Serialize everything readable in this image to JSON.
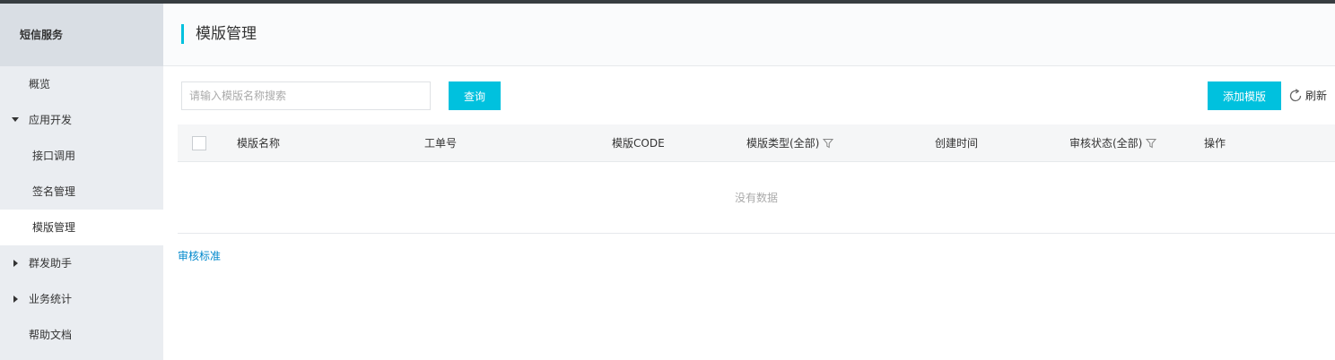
{
  "sidebar": {
    "title": "短信服务",
    "items": [
      {
        "label": "概览"
      },
      {
        "label": "应用开发"
      },
      {
        "label": "接口调用"
      },
      {
        "label": "签名管理"
      },
      {
        "label": "模版管理"
      },
      {
        "label": "群发助手"
      },
      {
        "label": "业务统计"
      },
      {
        "label": "帮助文档"
      }
    ]
  },
  "header": {
    "title": "模版管理"
  },
  "toolbar": {
    "search_placeholder": "请输入模版名称搜索",
    "query_label": "查询",
    "add_label": "添加模版",
    "refresh_label": "刷新"
  },
  "table": {
    "columns": [
      "模版名称",
      "工单号",
      "模版CODE",
      "模版类型(全部)",
      "创建时间",
      "审核状态(全部)",
      "操作"
    ],
    "empty_text": "没有数据"
  },
  "footer": {
    "audit_link": "审核标准"
  },
  "colors": {
    "accent": "#00c1de",
    "link": "#0088cc",
    "sidebar_bg": "#eaedf1"
  }
}
